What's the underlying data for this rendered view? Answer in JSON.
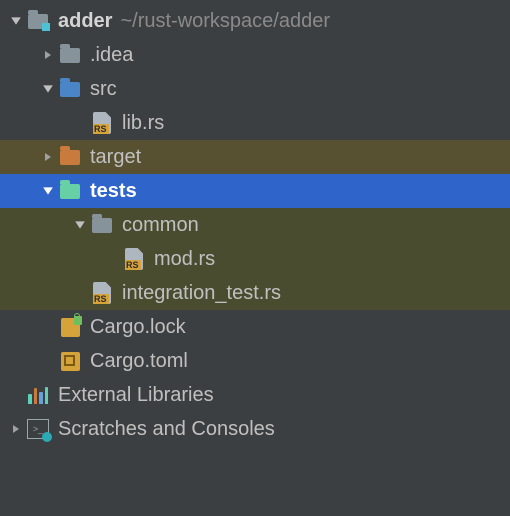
{
  "tree": {
    "root": {
      "name": "adder",
      "path": "~/rust-workspace/adder",
      "children": {
        "idea": {
          "label": ".idea"
        },
        "src": {
          "label": "src",
          "children": {
            "librs": {
              "label": "lib.rs"
            }
          }
        },
        "target": {
          "label": "target"
        },
        "tests": {
          "label": "tests",
          "children": {
            "common": {
              "label": "common",
              "children": {
                "modrs": {
                  "label": "mod.rs"
                }
              }
            },
            "integ": {
              "label": "integration_test.rs"
            }
          }
        },
        "cargoLock": {
          "label": "Cargo.lock"
        },
        "cargoToml": {
          "label": "Cargo.toml"
        }
      }
    },
    "externalLibs": {
      "label": "External Libraries"
    },
    "scratches": {
      "label": "Scratches and Consoles"
    }
  }
}
